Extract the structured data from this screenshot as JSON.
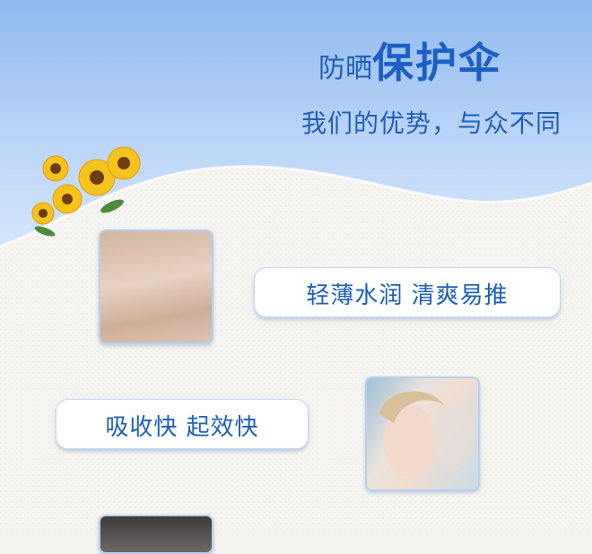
{
  "header": {
    "title_small": "防晒",
    "title_big": "保护伞",
    "subtitle": "我们的优势，与众不同"
  },
  "features": [
    {
      "label": "轻薄水润 清爽易推"
    },
    {
      "label": "吸收快 起效快"
    }
  ],
  "colors": {
    "accent": "#1f5fb8",
    "sky_top": "#8fb9ee",
    "paper": "#f4f3f0",
    "sunflower": "#f6c21c"
  }
}
